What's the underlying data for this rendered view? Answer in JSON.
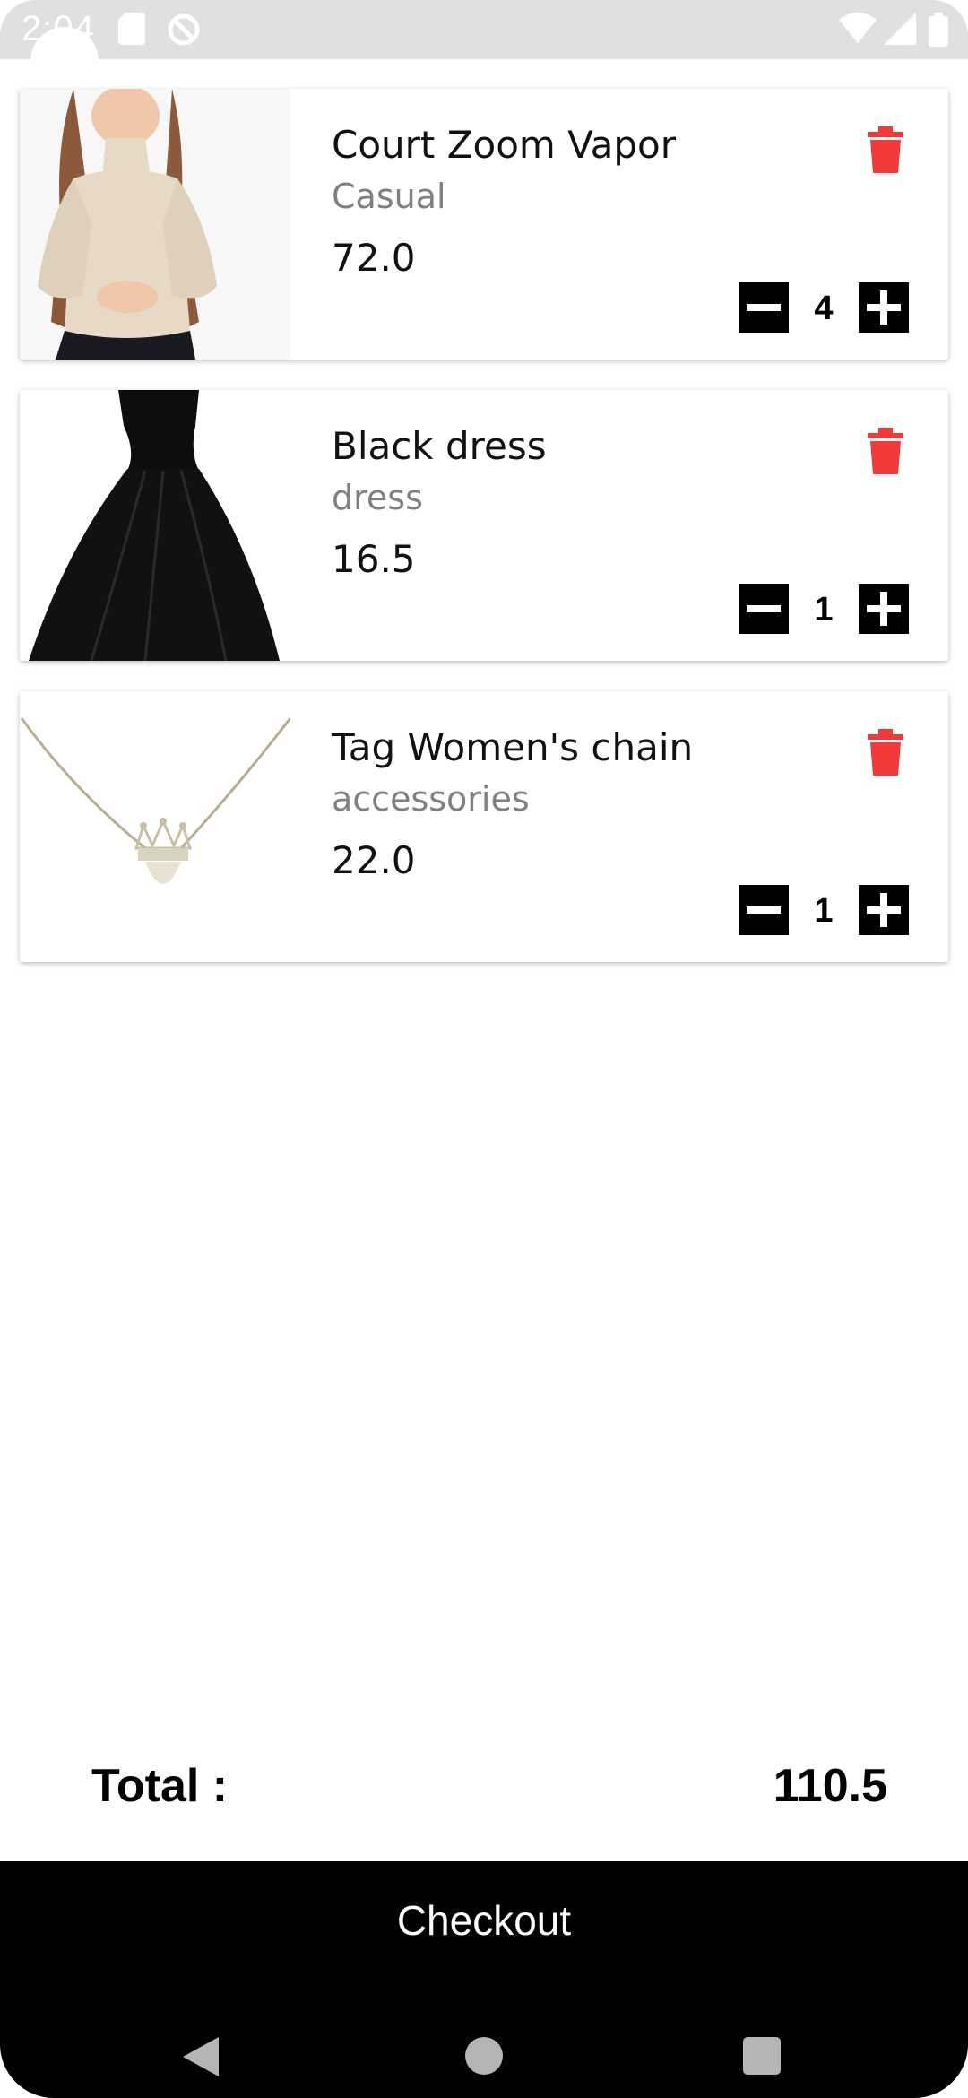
{
  "status_bar": {
    "time": "2:04",
    "icons": [
      "sd-card-icon",
      "do-not-disturb-icon",
      "wifi-icon",
      "signal-icon",
      "battery-icon"
    ]
  },
  "cart": {
    "items": [
      {
        "name": "Court Zoom Vapor",
        "category": "Casual",
        "price": "72.0",
        "quantity": "4",
        "image": "beige-turtleneck-photo"
      },
      {
        "name": "Black dress",
        "category": "dress",
        "price": "16.5",
        "quantity": "1",
        "image": "black-dress-photo"
      },
      {
        "name": "Tag Women's chain",
        "category": "accessories",
        "price": "22.0",
        "quantity": "1",
        "image": "crown-chain-necklace-photo"
      }
    ]
  },
  "total": {
    "label": "Total :",
    "value": "110.5"
  },
  "checkout": {
    "label": "Checkout"
  },
  "colors": {
    "delete": "#f23a3a",
    "accent": "#000000",
    "category_text": "#808080"
  }
}
